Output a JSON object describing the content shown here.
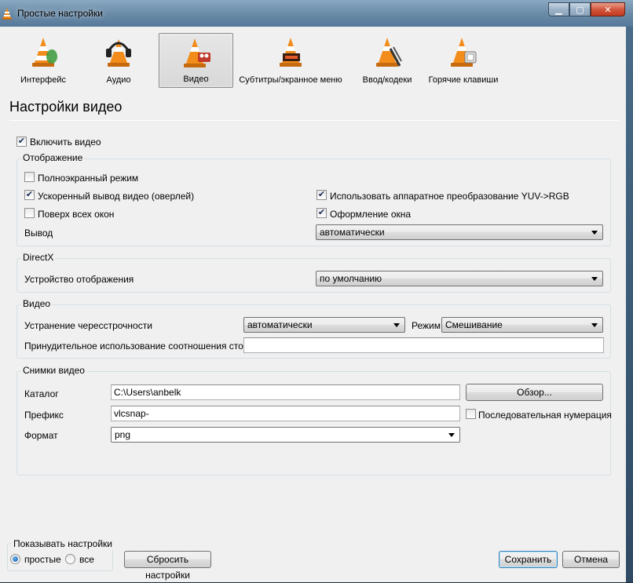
{
  "window": {
    "title": "Простые настройки"
  },
  "categories": [
    {
      "label": "Интерфейс",
      "icon": "cone-interface-icon"
    },
    {
      "label": "Аудио",
      "icon": "cone-headphones-icon"
    },
    {
      "label": "Видео",
      "icon": "cone-video-icon",
      "active": true
    },
    {
      "label": "Субтитры/экранное меню",
      "icon": "cone-subtitles-icon"
    },
    {
      "label": "Ввод/кодеки",
      "icon": "cone-input-codecs-icon"
    },
    {
      "label": "Горячие клавиши",
      "icon": "cone-hotkeys-icon"
    }
  ],
  "section_title": "Настройки видео",
  "enable_video": {
    "label": "Включить видео",
    "checked": true
  },
  "display": {
    "title": "Отображение",
    "fullscreen": {
      "label": "Полноэкранный режим",
      "checked": false
    },
    "overlay": {
      "label": "Ускоренный вывод видео (оверлей)",
      "checked": true
    },
    "on_top": {
      "label": "Поверх всех окон",
      "checked": false
    },
    "hw_yuv": {
      "label": "Использовать аппаратное преобразование YUV->RGB",
      "checked": true
    },
    "decorations": {
      "label": "Оформление окна",
      "checked": true
    },
    "output_label": "Вывод",
    "output_value": "автоматически"
  },
  "directx": {
    "title": "DirectX",
    "device_label": "Устройство отображения",
    "device_value": "по умолчанию"
  },
  "video": {
    "title": "Видео",
    "deinterlace_label": "Устранение чересстрочности",
    "deinterlace_value": "автоматически",
    "mode_label": "Режим",
    "mode_value": "Смешивание",
    "aspect_label": "Принудительное использование соотношения сторон",
    "aspect_value": ""
  },
  "snapshots": {
    "title": "Снимки видео",
    "dir_label": "Каталог",
    "dir_value": "C:\\Users\\anbelk",
    "browse_label": "Обзор...",
    "prefix_label": "Префикс",
    "prefix_value": "vlcsnap-",
    "sequential_label": "Последовательная нумерация",
    "sequential_checked": false,
    "format_label": "Формат",
    "format_value": "png"
  },
  "footer": {
    "show_settings_title": "Показывать настройки",
    "simple_label": "простые",
    "all_label": "все",
    "selected": "простые",
    "reset_label": "Сбросить настройки",
    "save_label": "Сохранить",
    "cancel_label": "Отмена"
  },
  "colors": {
    "cone_orange": "#f28c1a",
    "accent_blue": "#3c7fb1"
  }
}
